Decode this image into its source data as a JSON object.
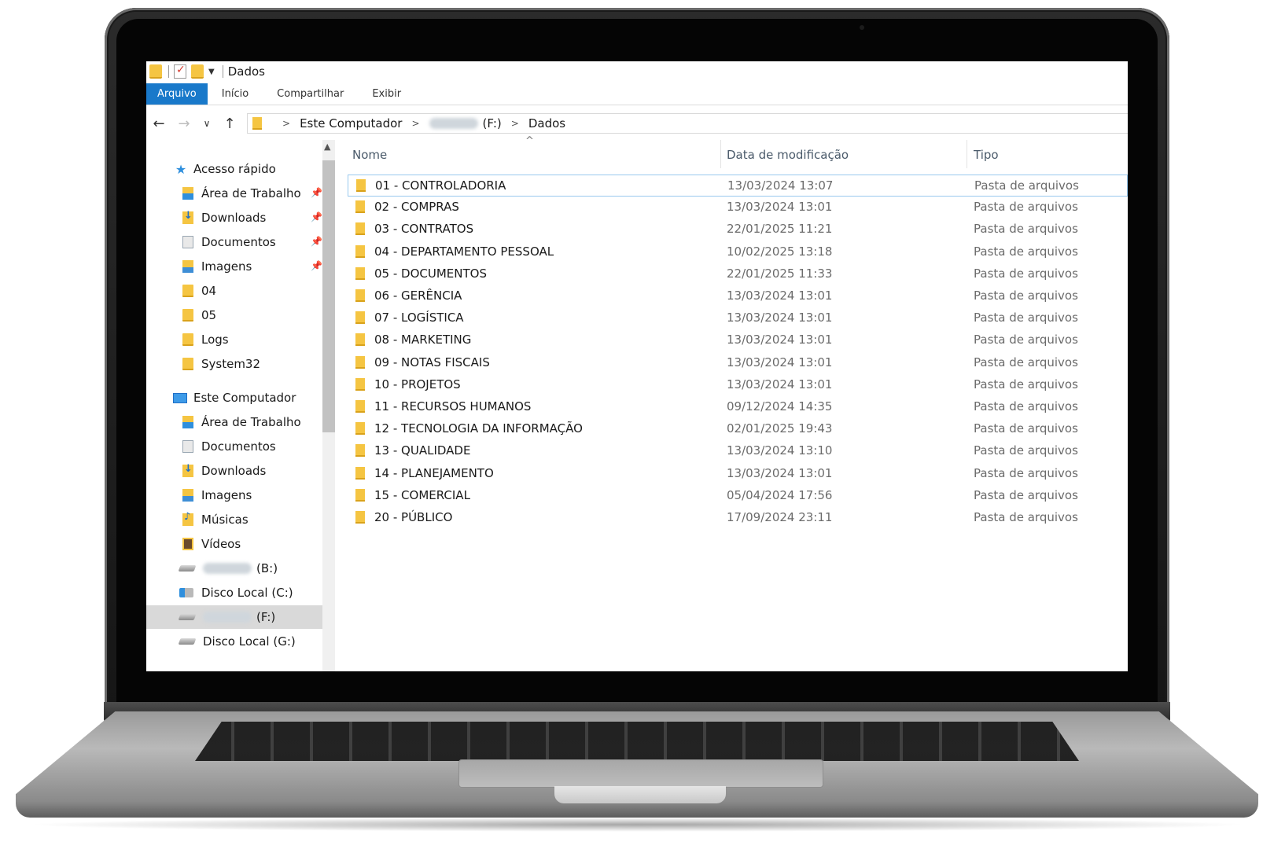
{
  "window": {
    "title": "Dados"
  },
  "ribbon": {
    "tabs": [
      "Arquivo",
      "Início",
      "Compartilhar",
      "Exibir"
    ]
  },
  "address": {
    "crumbs": [
      "Este Computador",
      "(F:)",
      "Dados"
    ]
  },
  "nav": {
    "quick_access": "Acesso rápido",
    "quick_items": [
      "Área de Trabalho",
      "Downloads",
      "Documentos",
      "Imagens",
      "04",
      "05",
      "Logs",
      "System32"
    ],
    "this_pc": "Este Computador",
    "pc_items": [
      "Área de Trabalho",
      "Documentos",
      "Downloads",
      "Imagens",
      "Músicas",
      "Vídeos"
    ],
    "drives": [
      "(B:)",
      "Disco Local (C:)",
      "(F:)",
      "Disco Local (G:)"
    ]
  },
  "columns": {
    "name": "Nome",
    "date": "Data de modificação",
    "type": "Tipo"
  },
  "files": [
    {
      "name": "01 - CONTROLADORIA",
      "date": "13/03/2024 13:07",
      "type": "Pasta de arquivos"
    },
    {
      "name": "02 - COMPRAS",
      "date": "13/03/2024 13:01",
      "type": "Pasta de arquivos"
    },
    {
      "name": "03 - CONTRATOS",
      "date": "22/01/2025 11:21",
      "type": "Pasta de arquivos"
    },
    {
      "name": "04 - DEPARTAMENTO PESSOAL",
      "date": "10/02/2025 13:18",
      "type": "Pasta de arquivos"
    },
    {
      "name": "05 - DOCUMENTOS",
      "date": "22/01/2025 11:33",
      "type": "Pasta de arquivos"
    },
    {
      "name": "06 - GERÊNCIA",
      "date": "13/03/2024 13:01",
      "type": "Pasta de arquivos"
    },
    {
      "name": "07 - LOGÍSTICA",
      "date": "13/03/2024 13:01",
      "type": "Pasta de arquivos"
    },
    {
      "name": "08 - MARKETING",
      "date": "13/03/2024 13:01",
      "type": "Pasta de arquivos"
    },
    {
      "name": "09 - NOTAS FISCAIS",
      "date": "13/03/2024 13:01",
      "type": "Pasta de arquivos"
    },
    {
      "name": "10 - PROJETOS",
      "date": "13/03/2024 13:01",
      "type": "Pasta de arquivos"
    },
    {
      "name": "11 - RECURSOS HUMANOS",
      "date": "09/12/2024 14:35",
      "type": "Pasta de arquivos"
    },
    {
      "name": "12 - TECNOLOGIA DA INFORMAÇÃO",
      "date": "02/01/2025 19:43",
      "type": "Pasta de arquivos"
    },
    {
      "name": "13 - QUALIDADE",
      "date": "13/03/2024 13:10",
      "type": "Pasta de arquivos"
    },
    {
      "name": "14 - PLANEJAMENTO",
      "date": "13/03/2024 13:01",
      "type": "Pasta de arquivos"
    },
    {
      "name": "15 - COMERCIAL",
      "date": "05/04/2024 17:56",
      "type": "Pasta de arquivos"
    },
    {
      "name": "20 - PÚBLICO",
      "date": "17/09/2024 23:11",
      "type": "Pasta de arquivos"
    }
  ],
  "colors": {
    "file_tab": "#1979ca",
    "folder": "#f5c542",
    "focus_border": "#99c9ef"
  }
}
